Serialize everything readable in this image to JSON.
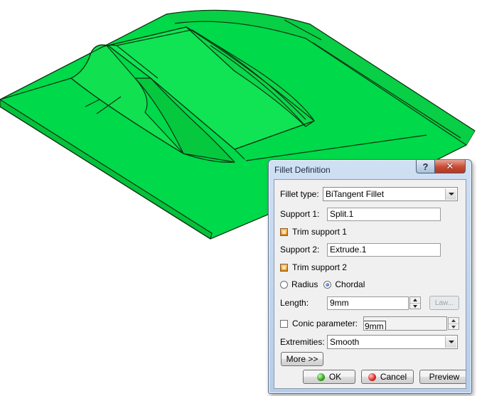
{
  "dialog": {
    "title": "Fillet Definition",
    "help_label": "?",
    "close_label": "✕",
    "fillet_type": {
      "label": "Fillet type:",
      "value": "BiTangent Fillet"
    },
    "support1": {
      "label": "Support 1:",
      "value": "Split.1"
    },
    "trim_support1": {
      "label": "Trim support 1",
      "checked": true
    },
    "support2": {
      "label": "Support 2:",
      "value": "Extrude.1"
    },
    "trim_support2": {
      "label": "Trim support 2",
      "checked": true
    },
    "radius_label": "Radius",
    "chordal_label": "Chordal",
    "mode_selected": "Chordal",
    "length": {
      "label": "Length:",
      "value": "9mm"
    },
    "law_button": "Law...",
    "conic": {
      "label": "Conic parameter:",
      "checked": false,
      "value": "9mm"
    },
    "extremities": {
      "label": "Extremities:",
      "value": "Smooth"
    },
    "more_button": "More >>",
    "ok_button": "OK",
    "cancel_button": "Cancel",
    "preview_button": "Preview"
  },
  "colors": {
    "surface": "#00d94a",
    "edge": "#0d3312",
    "dialog_frame": "#b6cde9",
    "ok_icon": "#2da315",
    "cancel_icon": "#d8261f"
  }
}
